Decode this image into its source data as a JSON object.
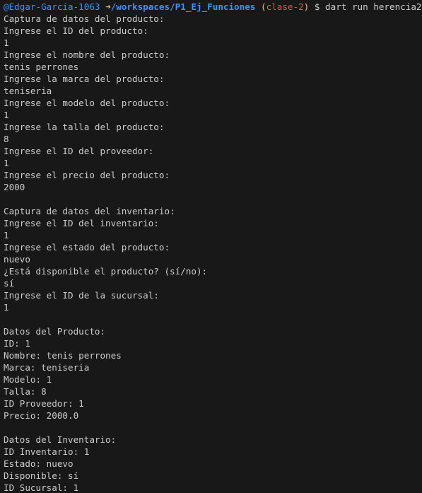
{
  "prompt": {
    "user": "@Edgar-Garcia-1063",
    "arrow": "➜",
    "path": "/workspaces/P1_Ej_Funciones",
    "branch_open": "(",
    "branch": "clase-2",
    "branch_close": ")",
    "symbol": "$",
    "command": "dart run herencia2.dart"
  },
  "output_lines": [
    "Captura de datos del producto:",
    "Ingrese el ID del producto:",
    "1",
    "Ingrese el nombre del producto:",
    "tenis perrones",
    "Ingrese la marca del producto:",
    "teniseria",
    "Ingrese el modelo del producto:",
    "1",
    "Ingrese la talla del producto:",
    "8",
    "Ingrese el ID del proveedor:",
    "1",
    "Ingrese el precio del producto:",
    "2000",
    "",
    "Captura de datos del inventario:",
    "Ingrese el ID del inventario:",
    "1",
    "Ingrese el estado del producto:",
    "nuevo",
    "¿Está disponible el producto? (sí/no):",
    "sí",
    "Ingrese el ID de la sucursal:",
    "1",
    "",
    "Datos del Producto:",
    "ID: 1",
    "Nombre: tenis perrones",
    "Marca: teniseria",
    "Modelo: 1",
    "Talla: 8",
    "ID Proveedor: 1",
    "Precio: 2000.0",
    "",
    "Datos del Inventario:",
    "ID Inventario: 1",
    "Estado: nuevo",
    "Disponible: sí",
    "ID Sucursal: 1"
  ]
}
